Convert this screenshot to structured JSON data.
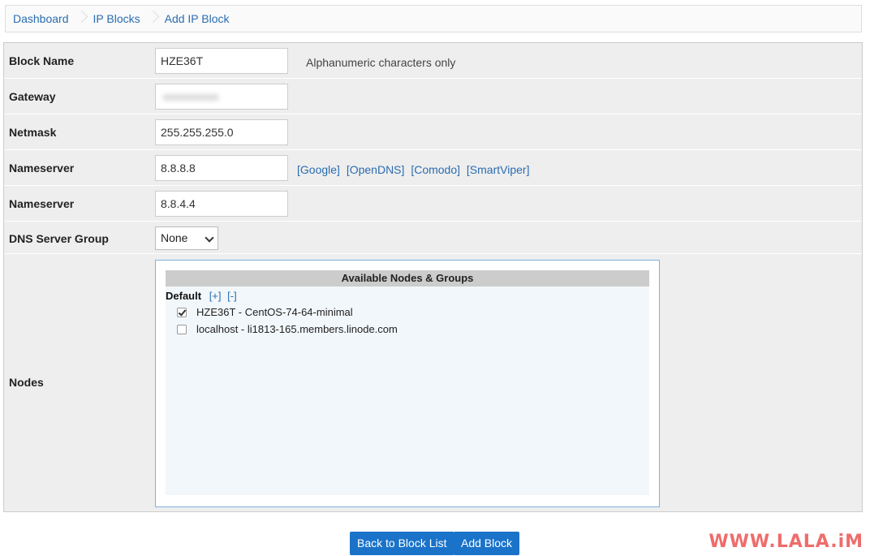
{
  "breadcrumb": {
    "items": [
      "Dashboard",
      "IP Blocks",
      "Add IP Block"
    ]
  },
  "form": {
    "block_name": {
      "label": "Block Name",
      "value": "HZE36T",
      "hint": "Alphanumeric characters only"
    },
    "gateway": {
      "label": "Gateway",
      "value": ""
    },
    "netmask": {
      "label": "Netmask",
      "value": "255.255.255.0"
    },
    "nameserver1": {
      "label": "Nameserver",
      "value": "8.8.8.8",
      "presets": [
        "[Google]",
        "[OpenDNS]",
        "[Comodo]",
        "[SmartViper]"
      ]
    },
    "nameserver2": {
      "label": "Nameserver",
      "value": "8.8.4.4"
    },
    "dns_group": {
      "label": "DNS Server Group",
      "selected": "None"
    },
    "nodes": {
      "label": "Nodes",
      "header": "Available Nodes & Groups",
      "group": {
        "name": "Default",
        "expand": "[+]",
        "collapse": "[-]"
      },
      "items": [
        {
          "label": "HZE36T - CentOS-74-64-minimal",
          "checked": true
        },
        {
          "label": "localhost - li1813-165.members.linode.com",
          "checked": false
        }
      ]
    }
  },
  "buttons": {
    "back": "Back to Block List",
    "add": "Add Block"
  },
  "watermark": "WWW.LALA.iM",
  "colors": {
    "accent": "#1a73c9",
    "link": "#2a6cb0",
    "watermark": "#ef6c6c"
  }
}
